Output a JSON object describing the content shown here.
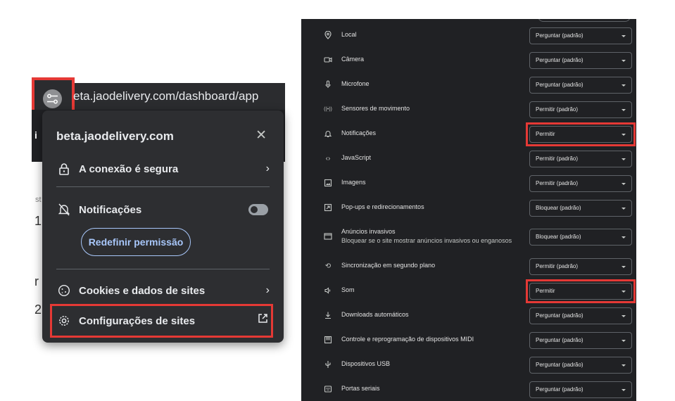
{
  "site_info": {
    "url": "eta.jaodelivery.com/dashboard/app",
    "domain": "beta.jaodelivery.com",
    "connection_label": "A conexão é segura",
    "notifications_label": "Notificações",
    "reset_permission_label": "Redefinir permissão",
    "cookies_label": "Cookies e dados de sites",
    "site_settings_label": "Configurações de sites",
    "close_symbol": "✕",
    "chevron": "›"
  },
  "background_letters": [
    "i",
    "st",
    "1",
    "r",
    "2"
  ],
  "permissions": [
    {
      "icon": "location-pin-icon",
      "label": "Local",
      "value": "Perguntar (padrão)"
    },
    {
      "icon": "camera-icon",
      "label": "Câmera",
      "value": "Perguntar (padrão)"
    },
    {
      "icon": "microphone-icon",
      "label": "Microfone",
      "value": "Perguntar (padrão)"
    },
    {
      "icon": "motion-sensor-icon",
      "label": "Sensores de movimento",
      "value": "Permitir (padrão)"
    },
    {
      "icon": "bell-icon",
      "label": "Notificações",
      "value": "Permitir"
    },
    {
      "icon": "code-icon",
      "label": "JavaScript",
      "value": "Permitir (padrão)"
    },
    {
      "icon": "image-icon",
      "label": "Imagens",
      "value": "Permitir (padrão)"
    },
    {
      "icon": "popup-icon",
      "label": "Pop-ups e redirecionamentos",
      "value": "Bloquear (padrão)"
    },
    {
      "icon": "ads-window-icon",
      "label": "Anúncios invasivos",
      "sublabel": "Bloquear se o site mostrar anúncios invasivos ou enganosos",
      "value": "Bloquear (padrão)"
    },
    {
      "icon": "sync-icon",
      "label": "Sincronização em segundo plano",
      "value": "Permitir (padrão)"
    },
    {
      "icon": "speaker-icon",
      "label": "Som",
      "value": "Permitir"
    },
    {
      "icon": "download-icon",
      "label": "Downloads automáticos",
      "value": "Perguntar (padrão)"
    },
    {
      "icon": "midi-piano-icon",
      "label": "Controle e reprogramação de dispositivos MIDI",
      "value": "Perguntar (padrão)"
    },
    {
      "icon": "usb-icon",
      "label": "Dispositivos USB",
      "value": "Perguntar (padrão)"
    },
    {
      "icon": "serial-port-icon",
      "label": "Portas seriais",
      "value": "Perguntar (padrão)"
    }
  ],
  "colors": {
    "highlight": "#e53935",
    "panel_bg": "#202124",
    "popup_bg": "#2d2e31",
    "accent": "#a8c7fa"
  }
}
